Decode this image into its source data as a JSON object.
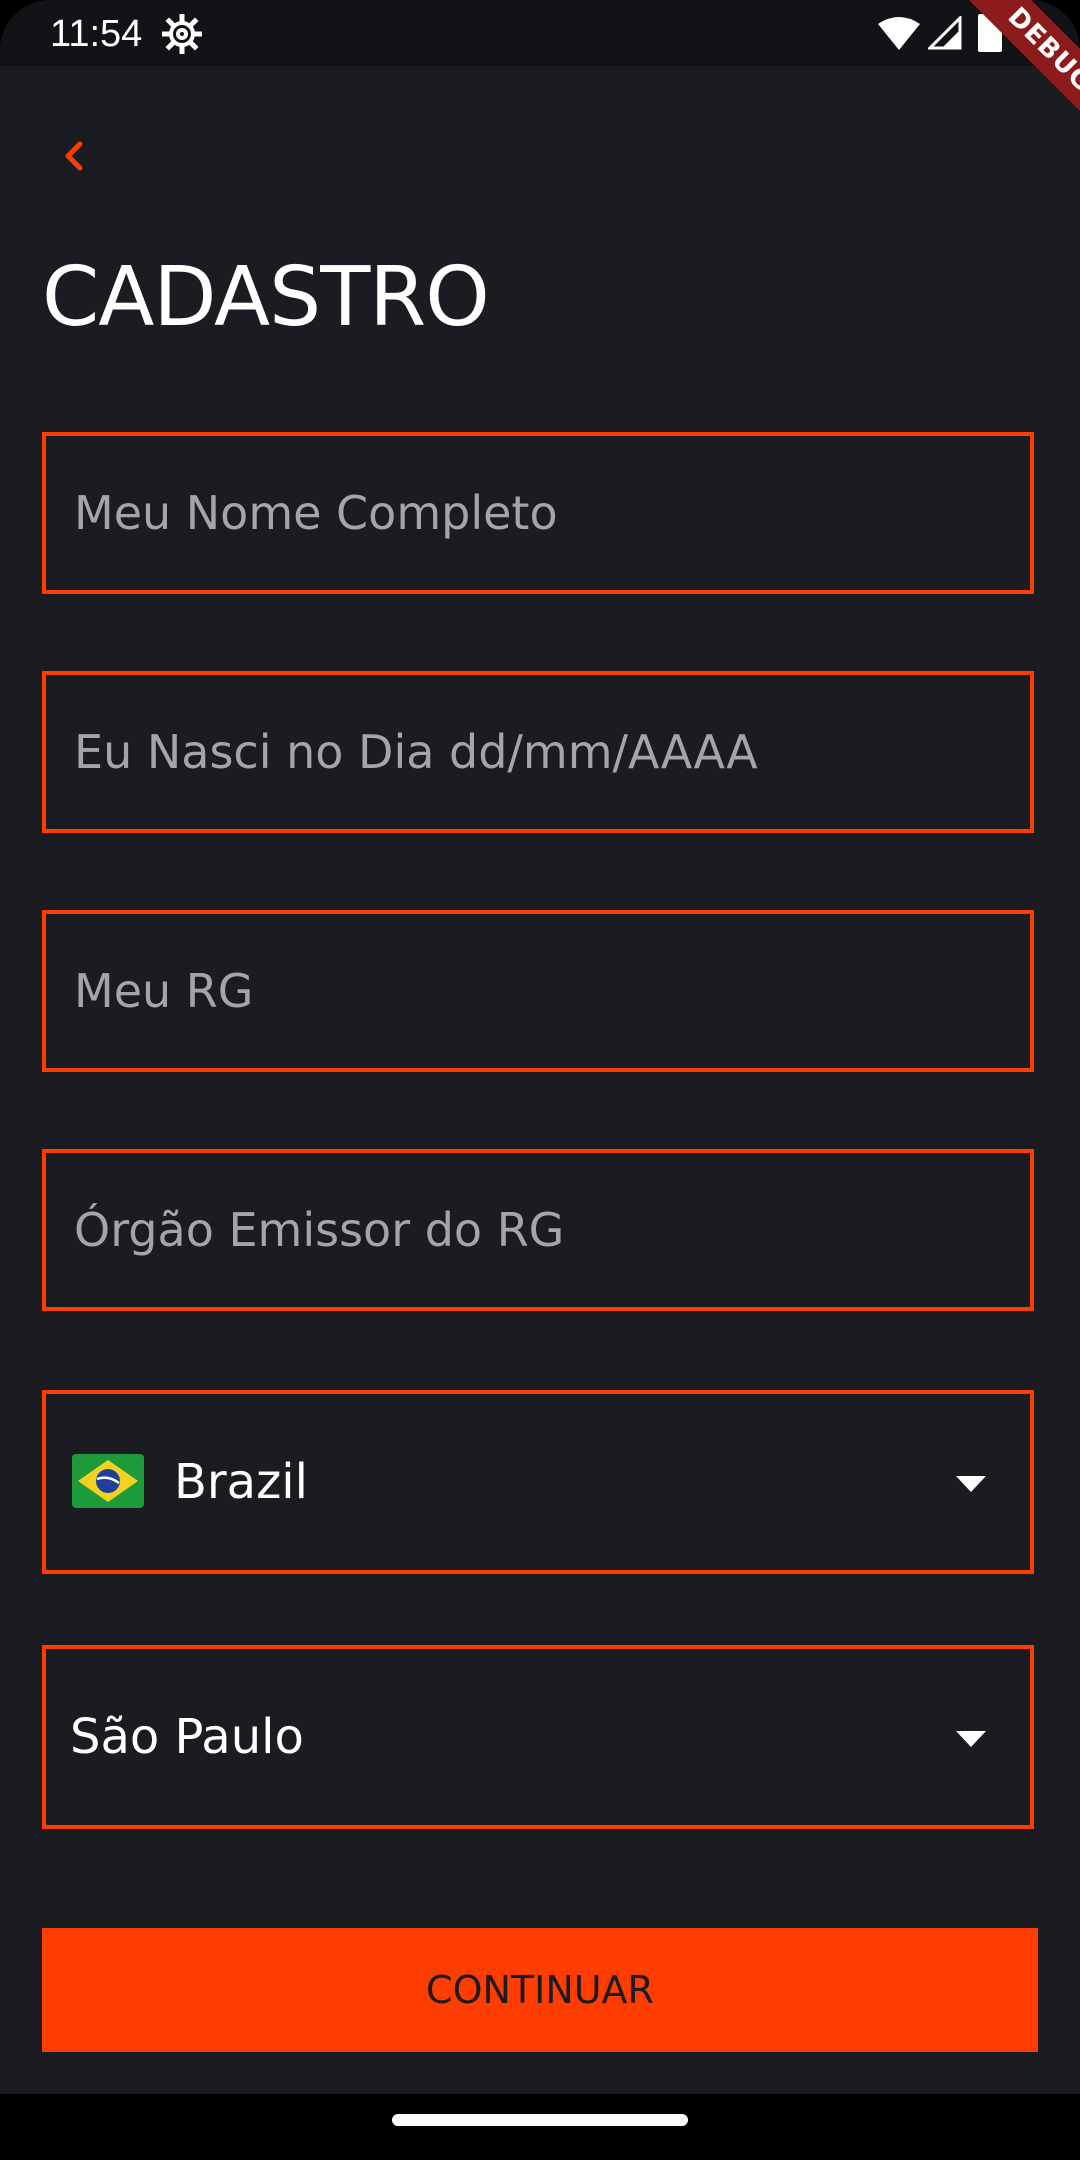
{
  "status_bar": {
    "time": "11:54",
    "icons": [
      "settings-gear-icon",
      "wifi-icon",
      "cell-signal-icon",
      "battery-icon"
    ],
    "debug_banner": "DEBUG"
  },
  "header": {
    "back_icon": "chevron-left-icon",
    "title": "CADASTRO"
  },
  "form": {
    "full_name": {
      "placeholder": "Meu Nome Completo",
      "value": ""
    },
    "birth_date": {
      "placeholder": "Eu Nasci no Dia dd/mm/AAAA",
      "value": ""
    },
    "rg": {
      "placeholder": "Meu RG",
      "value": ""
    },
    "rg_issuer": {
      "placeholder": "Órgão Emissor do RG",
      "value": ""
    },
    "country": {
      "selected": "Brazil",
      "flag_icon": "brazil-flag-icon"
    },
    "state": {
      "selected": "São Paulo"
    }
  },
  "actions": {
    "continue_label": "CONTINUAR"
  },
  "colors": {
    "accent": "#ff3d00",
    "background": "#1b1b22",
    "text": "#ffffff",
    "placeholder": "#a4a4ab",
    "debug_banner": "#8c1b1b"
  }
}
